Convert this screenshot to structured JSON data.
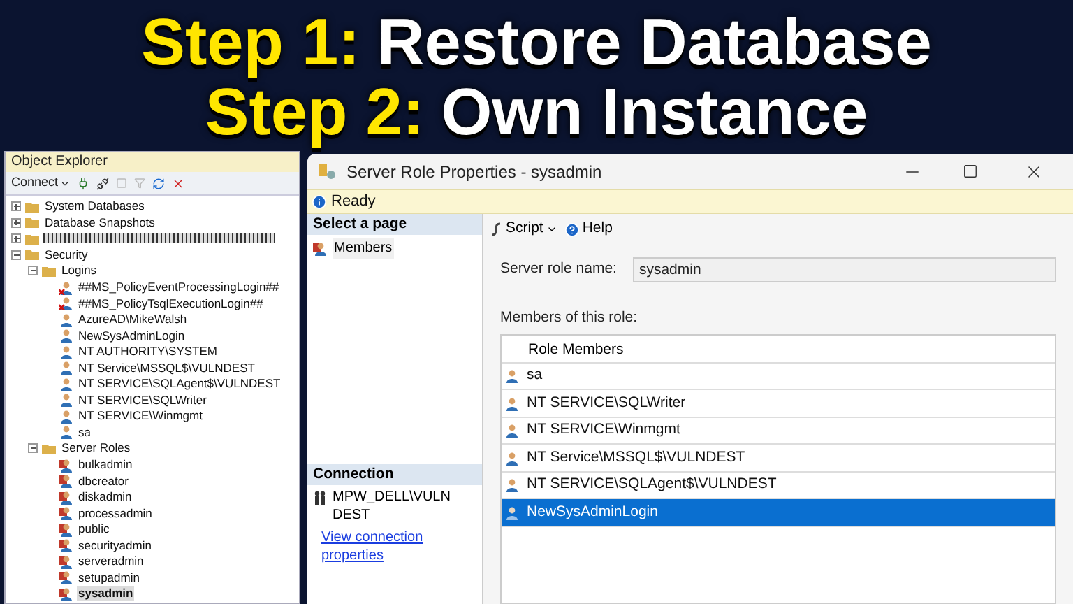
{
  "headline": [
    {
      "step": "Step 1:",
      "text": "Restore Database"
    },
    {
      "step": "Step 2:",
      "text": "Own Instance"
    }
  ],
  "object_explorer": {
    "title": "Object Explorer",
    "connect": "Connect",
    "tree": [
      {
        "kind": "folder",
        "label": "System Databases",
        "expanded": false
      },
      {
        "kind": "folder",
        "label": "Database Snapshots",
        "expanded": false
      },
      {
        "kind": "redacted",
        "expanded": false
      },
      {
        "kind": "folder",
        "label": "Security",
        "expanded": true,
        "children": [
          {
            "kind": "folder",
            "label": "Logins",
            "expanded": true,
            "children": [
              {
                "kind": "login",
                "label": "##MS_PolicyEventProcessingLogin##",
                "disabled": true,
                "selected": false
              },
              {
                "kind": "login",
                "label": "##MS_PolicyTsqlExecutionLogin##",
                "disabled": true,
                "selected": false
              },
              {
                "kind": "login",
                "label": "AzureAD\\MikeWalsh",
                "disabled": false,
                "selected": false
              },
              {
                "kind": "login",
                "label": "NewSysAdminLogin",
                "disabled": false,
                "selected": false
              },
              {
                "kind": "login",
                "label": "NT AUTHORITY\\SYSTEM",
                "disabled": false,
                "selected": false
              },
              {
                "kind": "login",
                "label": "NT Service\\MSSQL$\\VULNDEST",
                "disabled": false,
                "selected": false
              },
              {
                "kind": "login",
                "label": "NT SERVICE\\SQLAgent$\\VULNDEST",
                "disabled": false,
                "selected": false
              },
              {
                "kind": "login",
                "label": "NT SERVICE\\SQLWriter",
                "disabled": false,
                "selected": false
              },
              {
                "kind": "login",
                "label": "NT SERVICE\\Winmgmt",
                "disabled": false,
                "selected": false
              },
              {
                "kind": "login",
                "label": "sa",
                "disabled": false,
                "selected": false
              }
            ]
          },
          {
            "kind": "folder",
            "label": "Server Roles",
            "expanded": true,
            "children": [
              {
                "kind": "role",
                "label": "bulkadmin",
                "selected": false
              },
              {
                "kind": "role",
                "label": "dbcreator",
                "selected": false
              },
              {
                "kind": "role",
                "label": "diskadmin",
                "selected": false
              },
              {
                "kind": "role",
                "label": "processadmin",
                "selected": false
              },
              {
                "kind": "role",
                "label": "public",
                "selected": false
              },
              {
                "kind": "role",
                "label": "securityadmin",
                "selected": false
              },
              {
                "kind": "role",
                "label": "serveradmin",
                "selected": false
              },
              {
                "kind": "role",
                "label": "setupadmin",
                "selected": false
              },
              {
                "kind": "role",
                "label": "sysadmin",
                "selected": true
              }
            ]
          }
        ]
      }
    ]
  },
  "dialog": {
    "title": "Server Role Properties - sysadmin",
    "status": "Ready",
    "select_page": {
      "header": "Select a page",
      "pages": [
        {
          "label": "Members",
          "selected": true
        }
      ]
    },
    "connection": {
      "header": "Connection",
      "server": "MPW_DELL\\VULNDEST",
      "link": "View connection properties"
    },
    "toolbar": {
      "script": "Script",
      "help": "Help"
    },
    "role_name": {
      "label": "Server role name:",
      "value": "sysadmin"
    },
    "members": {
      "label": "Members of this role:",
      "column": "Role Members",
      "rows": [
        {
          "name": "sa",
          "selected": false
        },
        {
          "name": "NT SERVICE\\SQLWriter",
          "selected": false
        },
        {
          "name": "NT SERVICE\\Winmgmt",
          "selected": false
        },
        {
          "name": "NT Service\\MSSQL$\\VULNDEST",
          "selected": false
        },
        {
          "name": "NT SERVICE\\SQLAgent$\\VULNDEST",
          "selected": false
        },
        {
          "name": "NewSysAdminLogin",
          "selected": true
        }
      ]
    }
  }
}
